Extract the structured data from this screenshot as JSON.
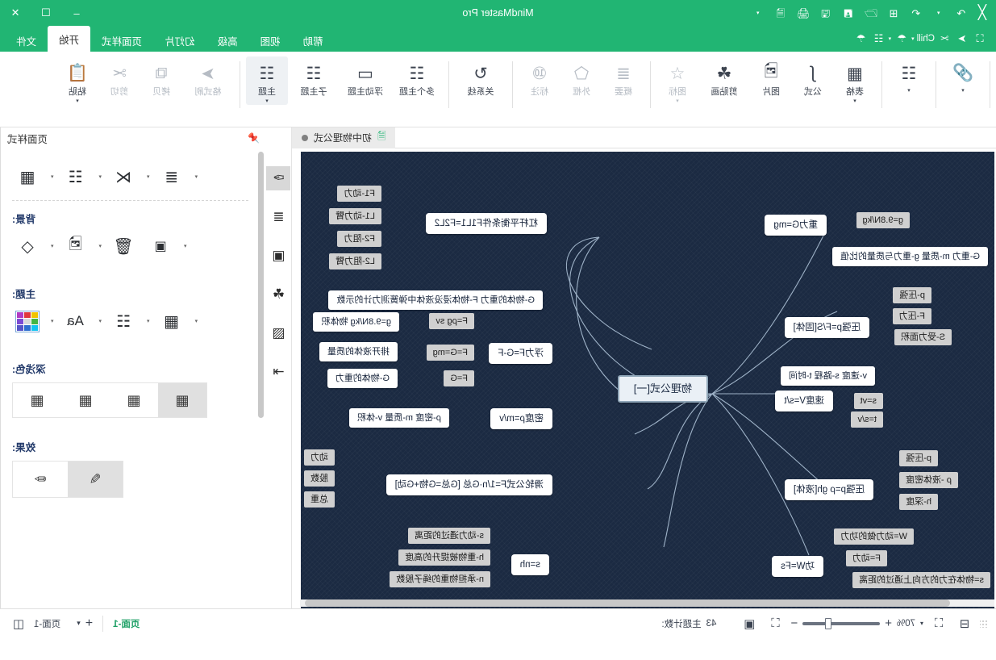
{
  "titlebar": {
    "app_title": "MindMaster Pro",
    "logo": "M",
    "left_icons": [
      "undo-icon",
      "redo-caret-icon",
      "redo-icon",
      "new-icon",
      "open-icon",
      "save-as-icon",
      "save-icon",
      "print-icon",
      "export-icon",
      "more-caret-icon"
    ],
    "window_buttons": [
      "minimize",
      "maximize",
      "close"
    ],
    "minimize_glyph": "–",
    "maximize_glyph": "☐",
    "close_glyph": "✕"
  },
  "menubar": {
    "tabs": [
      {
        "label": "文件",
        "active": false
      },
      {
        "label": "开始",
        "active": true
      },
      {
        "label": "页面样式",
        "active": false
      },
      {
        "label": "幻灯片",
        "active": false
      },
      {
        "label": "高级",
        "active": false
      },
      {
        "label": "视图",
        "active": false
      },
      {
        "label": "帮助",
        "active": false
      }
    ],
    "right_controls": [
      {
        "name": "fullscreen-icon",
        "glyph": "⛶"
      },
      {
        "name": "cursor-icon",
        "glyph": "➤"
      },
      {
        "name": "scissors-icon",
        "glyph": "✂"
      },
      {
        "name": "chill-label",
        "glyph": "Chill"
      },
      {
        "name": "shirt-icon",
        "glyph": "☂"
      },
      {
        "name": "grid-icon",
        "glyph": "⊞"
      },
      {
        "name": "home-icon",
        "glyph": "⌂"
      }
    ]
  },
  "ribbon": {
    "groups": [
      {
        "name": "clipboard",
        "items": [
          {
            "label": "粘贴",
            "icon": "clipboard-icon",
            "glyph": "📋",
            "dropdown": true,
            "disabled": false
          },
          {
            "label": "剪切",
            "icon": "scissors-icon",
            "glyph": "✂",
            "dropdown": false,
            "disabled": true
          },
          {
            "label": "拷贝",
            "icon": "copy-icon",
            "glyph": "⧉",
            "dropdown": false,
            "disabled": true
          },
          {
            "label": "格式刷",
            "icon": "format-painter-icon",
            "glyph": "➤",
            "dropdown": false,
            "disabled": true
          }
        ]
      },
      {
        "name": "topics",
        "items": [
          {
            "label": "主题",
            "icon": "topic-icon",
            "glyph": "⬚",
            "dropdown": true,
            "selected": true
          },
          {
            "label": "子主题",
            "icon": "subtopic-icon",
            "glyph": "⬚",
            "dropdown": false
          },
          {
            "label": "浮动主题",
            "icon": "floating-topic-icon",
            "glyph": "▭",
            "dropdown": false
          },
          {
            "label": "多个主题",
            "icon": "multi-topic-icon",
            "glyph": "⬚",
            "dropdown": false
          },
          {
            "label": "关系线",
            "icon": "relationship-icon",
            "glyph": "↺",
            "dropdown": false
          }
        ]
      },
      {
        "name": "annotate",
        "items": [
          {
            "label": "标注",
            "icon": "callout-icon",
            "glyph": "⊙",
            "dropdown": false,
            "disabled": true
          },
          {
            "label": "外框",
            "icon": "boundary-icon",
            "glyph": "⬠",
            "dropdown": false,
            "disabled": true
          },
          {
            "label": "概要",
            "icon": "summary-icon",
            "glyph": "≡",
            "dropdown": false,
            "disabled": true
          }
        ]
      },
      {
        "name": "insert",
        "items": [
          {
            "label": "图标",
            "icon": "icon-marker-icon",
            "glyph": "☆",
            "dropdown": true,
            "disabled": true
          },
          {
            "label": "剪贴画",
            "icon": "clipart-icon",
            "glyph": "☘",
            "dropdown": false
          },
          {
            "label": "图片",
            "icon": "image-icon",
            "glyph": "🖼",
            "dropdown": false
          },
          {
            "label": "公式",
            "icon": "formula-icon",
            "glyph": "∫",
            "dropdown": false
          },
          {
            "label": "表格",
            "icon": "table-icon",
            "glyph": "⊞",
            "dropdown": true
          }
        ]
      },
      {
        "name": "links",
        "items": [
          {
            "label": "",
            "icon": "hyperlink-icon",
            "glyph": "🔗",
            "dropdown": true
          },
          {
            "label": "",
            "icon": "structure-icon",
            "glyph": "⬚",
            "dropdown": true
          }
        ]
      }
    ]
  },
  "left_panel": {
    "title": "页面样式",
    "pin_icon": "pin-icon",
    "layout_row": [
      {
        "name": "layout-style-button",
        "glyph": "⬚",
        "dropdown": true
      },
      {
        "name": "structure-button",
        "glyph": "⬚",
        "dropdown": true
      },
      {
        "name": "branch-button",
        "glyph": "⑂",
        "dropdown": true
      },
      {
        "name": "list-button",
        "glyph": "≡",
        "dropdown": true
      }
    ],
    "sections": [
      {
        "label": "背景:",
        "buttons": [
          {
            "name": "fill-color-button",
            "glyph": "◇",
            "dropdown": true
          },
          {
            "name": "background-image-button",
            "glyph": "🖼",
            "dropdown": true
          },
          {
            "name": "delete-background-button",
            "glyph": "🗑",
            "dropdown": false
          },
          {
            "name": "watermark-button",
            "glyph": "A",
            "dropdown": true
          }
        ]
      },
      {
        "label": "主题:",
        "buttons": [
          {
            "name": "theme-variant-button",
            "glyph": "⬚",
            "dropdown": true
          },
          {
            "name": "theme-shape-button",
            "glyph": "⬚",
            "dropdown": true
          },
          {
            "name": "font-style-button",
            "glyph": "Aa",
            "dropdown": true
          },
          {
            "name": "color-palette-button",
            "glyph": "palette",
            "dropdown": true
          }
        ]
      },
      {
        "label": "深浅色:",
        "options": [
          "shade-1",
          "shade-2",
          "shade-3",
          "shade-4"
        ],
        "selected_index": 3
      },
      {
        "label": "效果:",
        "options": [
          "effect-hand-drawn",
          "effect-solid"
        ],
        "selected_index": 1
      }
    ],
    "rail_items": [
      {
        "name": "rail-style-icon",
        "glyph": "✑",
        "selected": true
      },
      {
        "name": "rail-outline-icon",
        "glyph": "≡",
        "selected": false
      },
      {
        "name": "rail-clipart-icon",
        "glyph": "☆",
        "selected": false
      },
      {
        "name": "rail-symbol-icon",
        "glyph": "☘",
        "selected": false
      },
      {
        "name": "rail-calendar-icon",
        "glyph": "Ὄ5",
        "selected": false
      },
      {
        "name": "rail-export-icon",
        "glyph": "⤒",
        "selected": false
      }
    ]
  },
  "document_tab": {
    "icon": "mindmap-file-icon",
    "label": "初中物理公式",
    "modified_dot": true
  },
  "mindmap": {
    "central": "物理公式[一]",
    "branches": [
      {
        "title": "杠杆平衡条件F1L1=F2L2",
        "children": [
          "F1-动力",
          "L1-动力臂",
          "F2-阻力",
          "L2-阻力臂"
        ],
        "note": ""
      },
      {
        "title": "浮力F=G-F",
        "children": [
          "F=ρg sv",
          "F=G=mg",
          "F=G"
        ],
        "child_notes": [
          "g=9.8N/kg  物体积",
          "排开液体的质量",
          "G-物体的重力"
        ],
        "note": "G-物体的重力  F-物体浸没液体中弹簧测力计的示数"
      },
      {
        "title": "密度ρ=m/v",
        "children": [],
        "note": "ρ-密度  m-质量  v-体积"
      },
      {
        "title": "滑轮公式F=1/n·G总 [G总=G物+G动]",
        "children": [
          "动力",
          "股数",
          "总重"
        ],
        "note": ""
      },
      {
        "title": "s=nh",
        "children": [
          "s-动力通过的距离",
          "h-重物被提升的高度",
          "n-承担物重的绳子股数"
        ],
        "note": ""
      },
      {
        "title": "重力G=mg",
        "children": [
          "g=9.8N/kg"
        ],
        "note": "G-重力  m-质量  g-重力与质量的比值"
      },
      {
        "title": "压强p=F/S[固体]",
        "children": [
          "p-压强",
          "F-压力",
          "S-受力面积"
        ],
        "note": ""
      },
      {
        "title": "速度V=s/t",
        "children": [
          "s=vt",
          "t=s/v"
        ],
        "note": "v-速度  s-路程  t-时间"
      },
      {
        "title": "压强p=ρ gh[液体]",
        "children": [
          "p-压强",
          "ρ -液体密度",
          "h-深度"
        ],
        "note": ""
      },
      {
        "title": "功W=Fs",
        "children": [
          "W=动力做的功力",
          "F=动力",
          "s=物体在力的方向上通过的距离"
        ],
        "note": ""
      }
    ]
  },
  "statusbar": {
    "fit_icon": "fit-page-icon",
    "actual_icon": "actual-size-icon",
    "zoom_out": "−",
    "zoom_in": "+",
    "zoom_level": "70%",
    "zoom_caret": "▾",
    "topic_count_label": "主题计数:",
    "topic_count_value": "43",
    "page_current": "页面-1",
    "page_add": "+",
    "page_menu_caret": "▾",
    "page_label": "页面-1",
    "view_icon": "page-view-icon"
  }
}
